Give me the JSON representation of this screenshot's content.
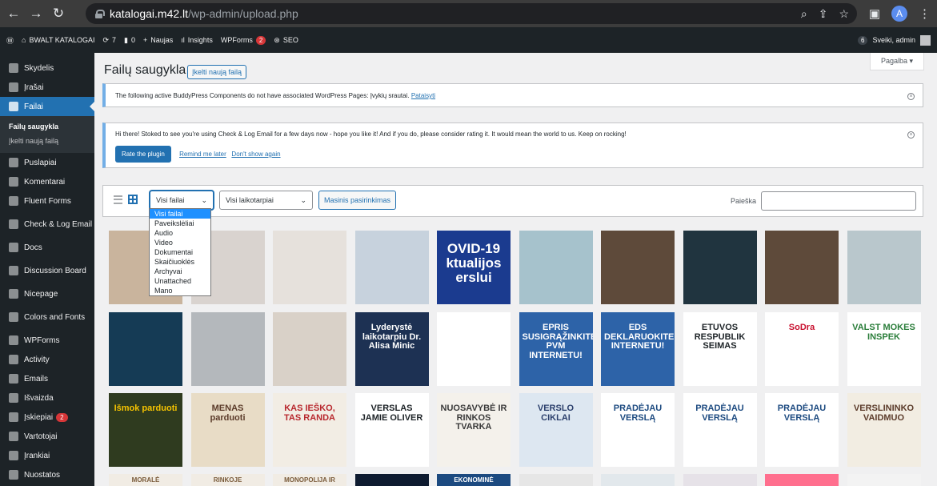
{
  "browser": {
    "url_host": "katalogai.m42.lt",
    "url_path": "/wp-admin/upload.php",
    "profile_initial": "A"
  },
  "adminbar": {
    "site_name": "BWALT KATALOGAI",
    "updates_count": "7",
    "comments_count": "0",
    "new_label": "Naujas",
    "insights_label": "Insights",
    "wpforms_label": "WPForms",
    "wpforms_badge": "2",
    "seo_label": "SEO",
    "greeting": "Sveiki, admin",
    "notif_count": "6"
  },
  "sidebar": {
    "items": [
      {
        "label": "Skydelis",
        "icon": "dashboard-icon"
      },
      {
        "label": "Įrašai",
        "icon": "pin-icon"
      },
      {
        "label": "Failai",
        "icon": "media-icon",
        "active": true
      },
      {
        "label": "Puslapiai",
        "icon": "page-icon"
      },
      {
        "label": "Komentarai",
        "icon": "comment-icon"
      },
      {
        "label": "Fluent Forms",
        "icon": "form-icon"
      },
      {
        "label": "Check & Log Email",
        "icon": "email-icon"
      },
      {
        "label": "Docs",
        "icon": "pin-icon"
      },
      {
        "label": "Discussion Board",
        "icon": "discussion-icon"
      },
      {
        "label": "Nicepage",
        "icon": "nicepage-icon"
      },
      {
        "label": "Colors and Fonts",
        "icon": "palette-icon"
      },
      {
        "label": "WPForms",
        "icon": "wpforms-icon"
      },
      {
        "label": "Activity",
        "icon": "activity-icon"
      },
      {
        "label": "Emails",
        "icon": "email-icon"
      },
      {
        "label": "Išvaizda",
        "icon": "brush-icon"
      },
      {
        "label": "Įskiepiai",
        "icon": "plugin-icon",
        "badge": "2"
      },
      {
        "label": "Vartotojai",
        "icon": "user-icon"
      },
      {
        "label": "Įrankiai",
        "icon": "wrench-icon"
      },
      {
        "label": "Nuostatos",
        "icon": "settings-icon"
      }
    ],
    "submenu": [
      "Failų saugykla",
      "Įkelti naują failą"
    ]
  },
  "main": {
    "help_label": "Pagalba ▾",
    "title": "Failų saugykla",
    "add_new_label": "Įkelti naują failą",
    "notice1": {
      "text": "The following active BuddyPress Components do not have associated WordPress Pages: Įvykių srautai.",
      "link": "Pataisyti"
    },
    "notice2": {
      "text": "Hi there! Stoked to see you're using Check & Log Email for a few days now - hope you like it! And if you do, please consider rating it. It would mean the world to us. Keep on rocking!",
      "rate_label": "Rate the plugin",
      "remind_label": "Remind me later",
      "dont_show_label": "Don't show again"
    },
    "filter": {
      "type_value": "Visi failai",
      "date_value": "Visi laikotarpiai",
      "bulk_label": "Masinis pasirinkimas",
      "search_label": "Paieška"
    },
    "type_options": [
      "Visi failai",
      "Paveikslėliai",
      "Audio",
      "Video",
      "Dokumentai",
      "Skaičiuoklės",
      "Archyvai",
      "Unattached",
      "Mano"
    ]
  },
  "thumbs": {
    "row1": [
      "",
      "",
      "",
      "",
      "OVID-19 ktualijos erslui",
      "",
      "",
      "",
      "",
      ""
    ],
    "row2": [
      "",
      "",
      "",
      "Lyderystė laikotarpiu Dr. Alisa Minic",
      "",
      "EPRIS SUSIGRĄŽINKITE PVM INTERNETU!",
      "EDS DEKLARUOKITE INTERNETU!",
      "ETUVOS RESPUBLIK SEIMAS",
      "SoDra",
      "VALST MOKES INSPEK"
    ],
    "row3": [
      "Išmok parduoti",
      "MENAS parduoti",
      "KAS IEŠKO, TAS RANDA",
      "VERSLAS JAMIE OLIVER",
      "NUOSAVYBĖ IR RINKOS TVARKA",
      "VERSLO CIKLAI",
      "PRADĖJAU VERSLĄ",
      "PRADĖJAU VERSLĄ",
      "PRADĖJAU VERSLĄ",
      "VERSLININKO VAIDMUO"
    ],
    "row4": [
      "MORALĖ",
      "RINKOJE",
      "MONOPOLIJA IR",
      "",
      "EKONOMINĖ",
      "",
      "",
      "",
      "",
      ""
    ]
  },
  "colors": {
    "accent": "#2271b1",
    "sidebar_bg": "#1d2327",
    "badge": "#d63638"
  }
}
